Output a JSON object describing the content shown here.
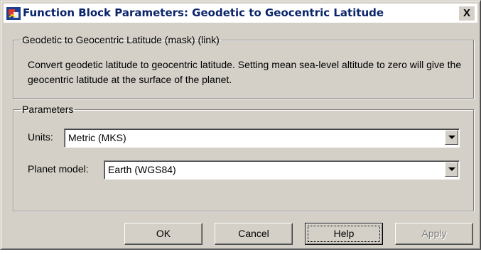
{
  "window": {
    "title": "Function Block Parameters: Geodetic to  Geocentric Latitude",
    "close_glyph": "X",
    "icon": "simulink-block-icon"
  },
  "mask_group": {
    "legend": "Geodetic to Geocentric Latitude (mask) (link)",
    "description": "Convert geodetic latitude to geocentric latitude. Setting mean sea-level altitude to zero will give the geocentric latitude at the surface of the planet."
  },
  "parameters_group": {
    "legend": "Parameters",
    "units": {
      "label": "Units:",
      "value": "Metric (MKS)"
    },
    "planet_model": {
      "label": "Planet model:",
      "value": "Earth (WGS84)"
    }
  },
  "buttons": {
    "ok": "OK",
    "cancel": "Cancel",
    "help": "Help",
    "apply": "Apply"
  }
}
